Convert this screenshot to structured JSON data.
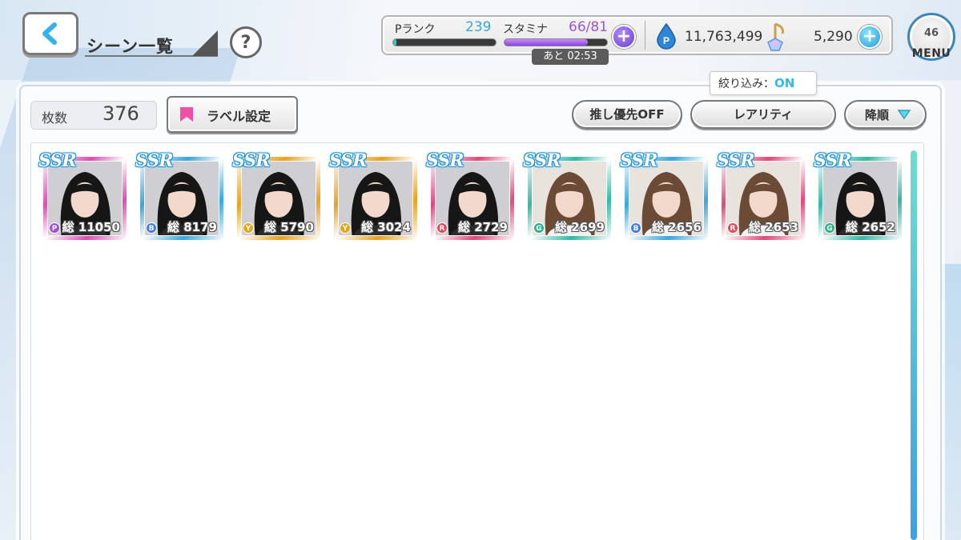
{
  "header": {
    "back_icon": "back-arrow-icon",
    "title": "シーン一覧",
    "help_label": "?"
  },
  "status": {
    "prank_label": "Pランク",
    "prank_value": "239",
    "prank_progress": 0.03,
    "stamina_label": "スタミナ",
    "stamina_value": "66/81",
    "stamina_progress": 0.81,
    "stamina_timer": "あと 02:53",
    "p_currency": "11,763,499",
    "gem_currency": "5,290",
    "plus_label": "+"
  },
  "menu": {
    "badge": "46",
    "label": "MENU"
  },
  "toolbar": {
    "count_label": "枚数",
    "count_value": "376",
    "label_button": "ラベル設定",
    "oshi_button": "推し優先OFF",
    "rarity_button": "レアリティ",
    "sort_button": "降順",
    "filter_prefix": "絞り込み：",
    "filter_state": "ON"
  },
  "colors": {
    "accent_blue": "#38a6d9",
    "stamina_purple": "#9a55d8",
    "filter_on": "#37b9e8"
  },
  "cards": [
    {
      "rarity": "SSR",
      "type": "P",
      "power": "総 11050",
      "frame": "#d94fb5",
      "type_color": "#a34fd6"
    },
    {
      "rarity": "SSR",
      "type": "B",
      "power": "総 8179",
      "frame": "#3aa6d8",
      "type_color": "#3d7de0"
    },
    {
      "rarity": "SSR",
      "type": "Y",
      "power": "総 5790",
      "frame": "#e5a21f",
      "type_color": "#e0a81c"
    },
    {
      "rarity": "SSR",
      "type": "Y",
      "power": "総 3024",
      "frame": "#e5a21f",
      "type_color": "#e0a81c"
    },
    {
      "rarity": "SSR",
      "type": "R",
      "power": "総 2729",
      "frame": "#e0487a",
      "type_color": "#e04a5a"
    },
    {
      "rarity": "SSR",
      "type": "G",
      "power": "総 2699",
      "frame": "#34b7a6",
      "type_color": "#2fb08a"
    },
    {
      "rarity": "SSR",
      "type": "B",
      "power": "総 2656",
      "frame": "#3aa6d8",
      "type_color": "#3d7de0"
    },
    {
      "rarity": "SSR",
      "type": "R",
      "power": "総 2653",
      "frame": "#e0487a",
      "type_color": "#e04a5a"
    },
    {
      "rarity": "SSR",
      "type": "G",
      "power": "総 2652",
      "frame": "#34b7a6",
      "type_color": "#2fb08a"
    }
  ]
}
